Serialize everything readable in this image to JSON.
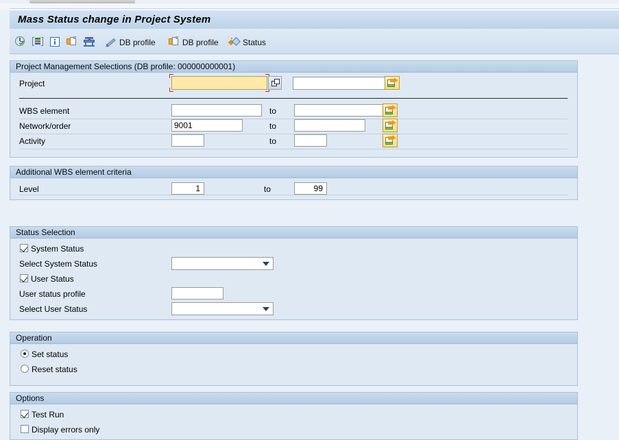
{
  "window": {
    "title": "Mass Status change in Project System"
  },
  "toolbar": {
    "items": [
      {
        "icon": "execute-icon",
        "label": ""
      },
      {
        "icon": "variants-icon",
        "label": ""
      },
      {
        "icon": "info-icon",
        "label": ""
      },
      {
        "icon": "get-variant-icon",
        "label": ""
      },
      {
        "icon": "db-profile-icon",
        "label": ""
      },
      {
        "icon": "pencil-icon",
        "label": "DB profile"
      },
      {
        "icon": "folder-page-icon",
        "label": "DB profile"
      },
      {
        "icon": "status-icon",
        "label": "Status"
      }
    ]
  },
  "sections": {
    "project_management": {
      "header": "Project Management Selections (DB profile: 000000000001)",
      "rows": {
        "project": {
          "label": "Project",
          "value": "",
          "to_value": ""
        },
        "wbs_element": {
          "label": "WBS element",
          "value": "",
          "to_label": "to",
          "to_value": ""
        },
        "network_order": {
          "label": "Network/order",
          "value": "9001",
          "to_label": "to",
          "to_value": ""
        },
        "activity": {
          "label": "Activity",
          "value": "",
          "to_label": "to",
          "to_value": ""
        }
      }
    },
    "additional_wbs": {
      "header": "Additional WBS element criteria",
      "rows": {
        "level": {
          "label": "Level",
          "value": "1",
          "to_label": "to",
          "to_value": "99"
        }
      }
    },
    "status_selection": {
      "header": "Status Selection",
      "system_status": {
        "label": "System Status",
        "checked": true
      },
      "select_system_status": {
        "label": "Select System Status",
        "value": ""
      },
      "user_status": {
        "label": "User Status",
        "checked": true
      },
      "user_status_profile": {
        "label": "User status profile",
        "value": ""
      },
      "select_user_status": {
        "label": "Select User Status",
        "value": ""
      }
    },
    "operation": {
      "header": "Operation",
      "options": [
        {
          "label": "Set status",
          "selected": true
        },
        {
          "label": "Reset status",
          "selected": false
        }
      ]
    },
    "options": {
      "header": "Options",
      "items": [
        {
          "label": "Test Run",
          "checked": true
        },
        {
          "label": "Display errors only",
          "checked": false
        }
      ]
    }
  },
  "colors": {
    "panel_bg": "#dee9f3",
    "panel_border": "#a7c1da",
    "focus_field": "#ffe9a8",
    "focus_marker": "#e02020",
    "page_bg": "#eaf0f7"
  }
}
